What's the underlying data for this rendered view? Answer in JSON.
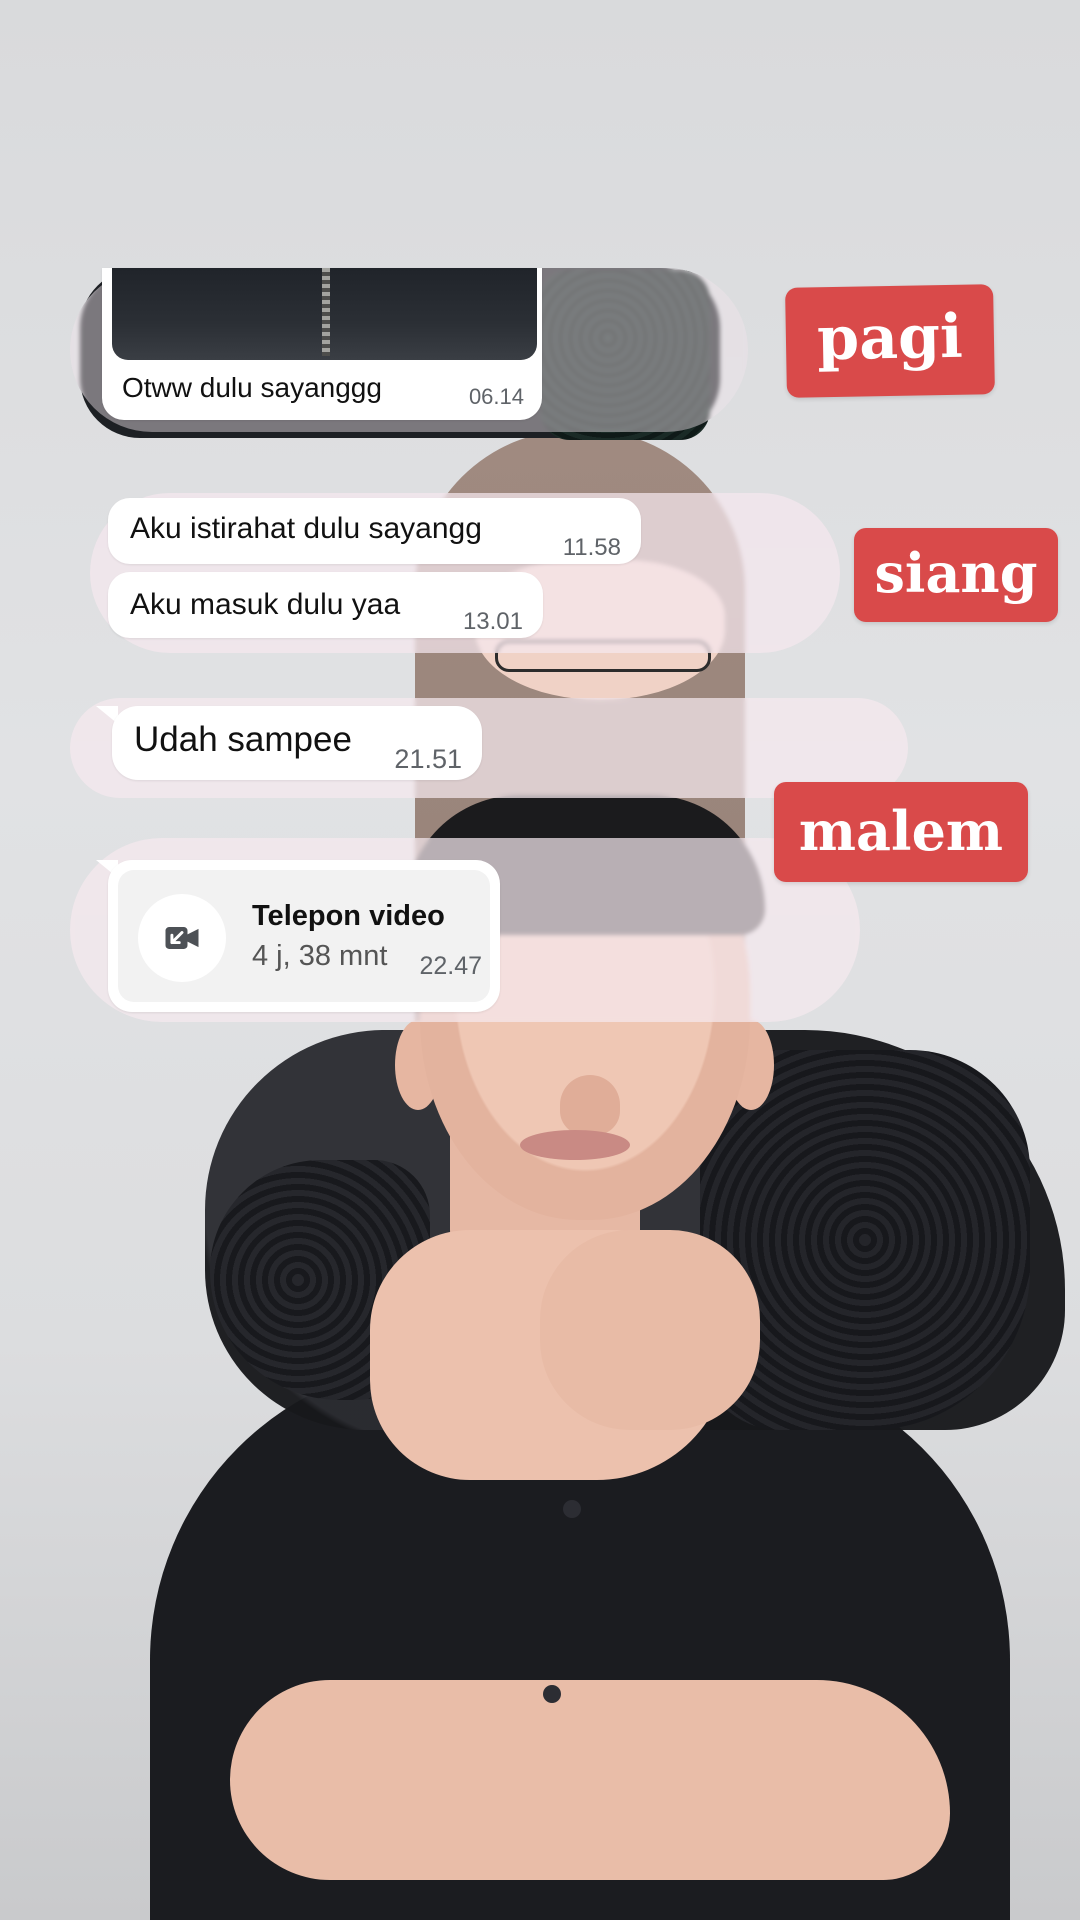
{
  "messages": [
    {
      "text": "Otww dulu sayanggg",
      "time": "06.14"
    },
    {
      "text": "Aku istirahat dulu sayangg",
      "time": "11.58"
    },
    {
      "text": "Aku masuk dulu yaa",
      "time": "13.01"
    },
    {
      "text": "Udah sampee",
      "time": "21.51"
    }
  ],
  "call": {
    "title": "Telepon video",
    "duration": "4 j, 38 mnt",
    "time": "22.47",
    "icon": "video-call-incoming-icon"
  },
  "labels": {
    "morning": "pagi",
    "afternoon": "siang",
    "night": "malem"
  },
  "colors": {
    "label_bg": "#d94a4a",
    "bubble_bg": "#ffffff",
    "strip_bg": "#f5e9ef"
  }
}
